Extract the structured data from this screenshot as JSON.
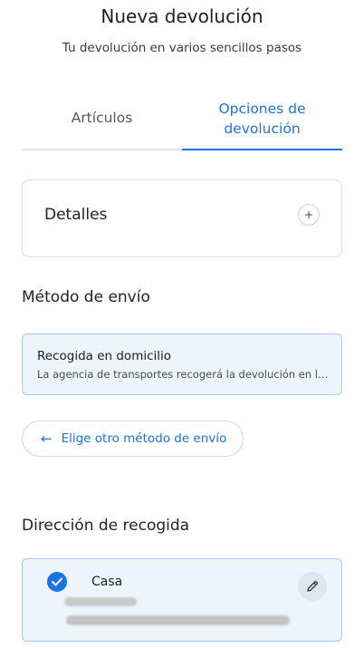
{
  "header": {
    "title": "Nueva devolución",
    "subtitle": "Tu devolución en varios sencillos pasos"
  },
  "tabs": [
    {
      "label": "Artículos",
      "active": false
    },
    {
      "label": "Opciones de devolución",
      "active": true
    }
  ],
  "details": {
    "label": "Detalles",
    "expand_icon": "plus-icon"
  },
  "shipping": {
    "section_title": "Método de envío",
    "selected_method": {
      "title": "Recogida en domicilio",
      "description": "La agencia de transportes recogerá la devolución en la dirección indicada"
    },
    "change_button": {
      "label": "Elige otro método de envío",
      "icon": "arrow-left-icon"
    }
  },
  "pickup_address": {
    "section_title": "Dirección de recogida",
    "name": "Casa",
    "selected": true,
    "edit_icon": "pencil-icon"
  },
  "colors": {
    "accent": "#1a73e8",
    "selected_card_bg": "#eef4fb",
    "selected_card_border": "#a9c8ec"
  }
}
